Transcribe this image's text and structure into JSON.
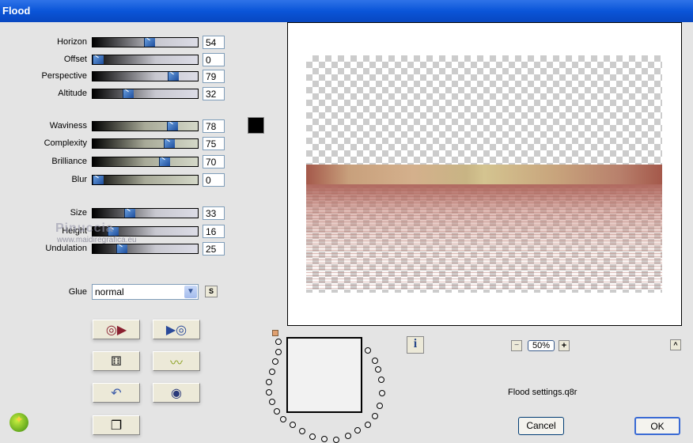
{
  "window": {
    "title": "Flood"
  },
  "sliders": [
    {
      "label": "Horizon",
      "value": 54,
      "style": "gray"
    },
    {
      "label": "Offset",
      "value": 0,
      "style": "gray"
    },
    {
      "label": "Perspective",
      "value": 79,
      "style": "gray"
    },
    {
      "label": "Altitude",
      "value": 32,
      "style": "gray"
    },
    {
      "label": "Waviness",
      "value": 78,
      "style": "olive"
    },
    {
      "label": "Complexity",
      "value": 75,
      "style": "olive"
    },
    {
      "label": "Brilliance",
      "value": 70,
      "style": "olive"
    },
    {
      "label": "Blur",
      "value": 0,
      "style": "olive"
    },
    {
      "label": "Size",
      "value": 33,
      "style": "gray"
    },
    {
      "label": "Height",
      "value": 16,
      "style": "gray"
    },
    {
      "label": "Undulation",
      "value": 25,
      "style": "gray"
    }
  ],
  "color_swatch": "#000000",
  "glue": {
    "label": "Glue",
    "value": "normal",
    "s_button": "S"
  },
  "watermark": {
    "name": "Pinuccia",
    "url": "www.maidiregrafica.eu"
  },
  "tool_buttons": [
    {
      "name": "load-preset-button",
      "icon": "disc-play-red-icon",
      "glyph": "◎▶"
    },
    {
      "name": "save-preset-button",
      "icon": "play-disc-blue-icon",
      "glyph": "▶◎"
    },
    {
      "name": "randomize-button",
      "icon": "dice-icon",
      "glyph": "⚅"
    },
    {
      "name": "wave-button",
      "icon": "wave-icon",
      "glyph": "〰"
    },
    {
      "name": "reset-button",
      "icon": "undo-icon",
      "glyph": "↶"
    },
    {
      "name": "ring-button",
      "icon": "ring-icon",
      "glyph": "◉"
    },
    {
      "name": "copy-button",
      "icon": "copy-icon",
      "glyph": "❐"
    }
  ],
  "info_button": "i",
  "zoom": {
    "minus": "−",
    "value": "50%",
    "plus": "+"
  },
  "collapse_button": "^",
  "settings_file": "Flood settings.q8r",
  "buttons": {
    "cancel": "Cancel",
    "ok": "OK"
  }
}
